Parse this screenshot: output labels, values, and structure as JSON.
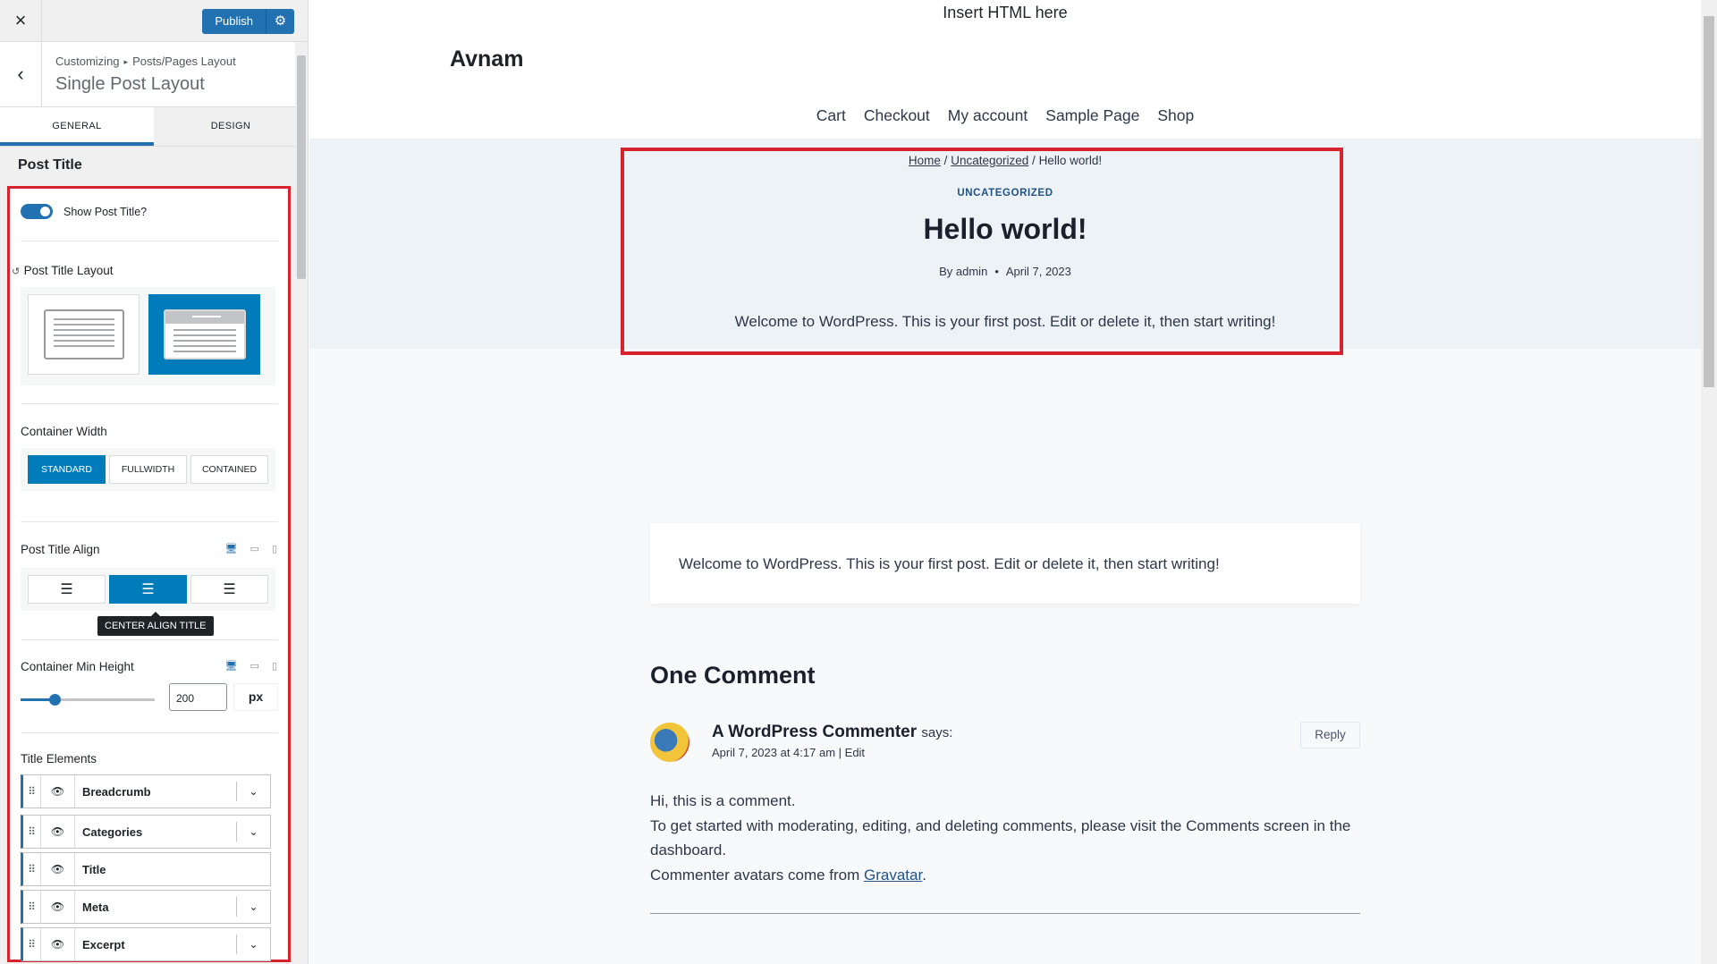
{
  "sidebar": {
    "close_icon": "×",
    "publish_label": "Publish",
    "gear_icon": "⚙",
    "back_icon": "‹",
    "breadcrumb_root": "Customizing",
    "breadcrumb_sep": "▸",
    "breadcrumb_parent": "Posts/Pages Layout",
    "title": "Single Post Layout",
    "tabs": [
      {
        "label": "GENERAL"
      },
      {
        "label": "DESIGN"
      }
    ],
    "section_title": "Post Title",
    "show_title_label": "Show Post Title?",
    "layout_label": "Post Title Layout",
    "reset_icon": "↺",
    "container_width_label": "Container Width",
    "container_width_options": [
      "STANDARD",
      "FULLWIDTH",
      "CONTAINED"
    ],
    "align_label": "Post Title Align",
    "align_icons": [
      "☰",
      "☰",
      "☰"
    ],
    "tooltip": "CENTER ALIGN TITLE",
    "device_icons": [
      "🖥",
      "▭",
      "▯"
    ],
    "min_height_label": "Container Min Height",
    "min_height_value": "200",
    "min_height_unit": "px",
    "min_height_fraction": 0.25,
    "title_elements_label": "Title Elements",
    "title_elements": [
      {
        "name": "Breadcrumb"
      },
      {
        "name": "Categories"
      },
      {
        "name": "Title"
      },
      {
        "name": "Meta"
      },
      {
        "name": "Excerpt"
      }
    ],
    "drag_icon": "⠿",
    "eye_icon": "👁",
    "chevron_icon": "⌄"
  },
  "preview": {
    "insert_html": "Insert HTML here",
    "site_title": "Avnam",
    "nav": [
      "Cart",
      "Checkout",
      "My account",
      "Sample Page",
      "Shop"
    ],
    "breadcrumb": {
      "home": "Home",
      "sep": "/",
      "category": "Uncategorized",
      "current": "Hello world!"
    },
    "category": "UNCATEGORIZED",
    "post_title": "Hello world!",
    "meta": {
      "author": "By admin",
      "dot": "•",
      "date": "April 7, 2023"
    },
    "excerpt": "Welcome to WordPress. This is your first post. Edit or delete it, then start writing!",
    "content": "Welcome to WordPress. This is your first post. Edit or delete it, then start writing!",
    "comments_title": "One Comment",
    "comment": {
      "author": "A WordPress Commenter",
      "says": "says:",
      "date": "April 7, 2023 at 4:17 am",
      "edit": "| Edit",
      "reply": "Reply",
      "line1": "Hi, this is a comment.",
      "line2": "To get started with moderating, editing, and deleting comments, please visit the Comments screen in the dashboard.",
      "line3_prefix": "Commenter avatars come from ",
      "line3_link": "Gravatar",
      "line3_suffix": "."
    }
  }
}
